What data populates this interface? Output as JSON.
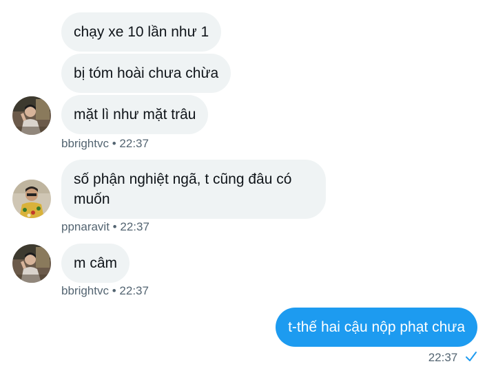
{
  "messages": [
    {
      "group": "bbrightvc-1",
      "sender": "bbrightvc",
      "time": "22:37",
      "bubbles": [
        "chạy xe 10 lần như 1",
        "bị tóm hoài chưa chừa",
        "mặt lì như mặt trâu"
      ]
    },
    {
      "group": "ppnaravit-1",
      "sender": "ppnaravit",
      "time": "22:37",
      "bubbles": [
        "số phận nghiệt ngã, t cũng đâu có muốn"
      ]
    },
    {
      "group": "bbrightvc-2",
      "sender": "bbrightvc",
      "time": "22:37",
      "bubbles": [
        "m câm"
      ]
    },
    {
      "group": "outgoing",
      "sender": "",
      "time": "22:37",
      "bubbles": [
        "t-thế hai cậu nộp phạt chưa"
      ]
    }
  ],
  "separator": "•",
  "icons": {
    "read_receipt": "checkmark-icon",
    "avatar_bbrightvc": "avatar-bbrightvc",
    "avatar_ppnaravit": "avatar-ppnaravit"
  },
  "colors": {
    "incoming_bubble": "#eff3f4",
    "outgoing_bubble": "#1d9bf0",
    "meta_text": "#536471"
  }
}
